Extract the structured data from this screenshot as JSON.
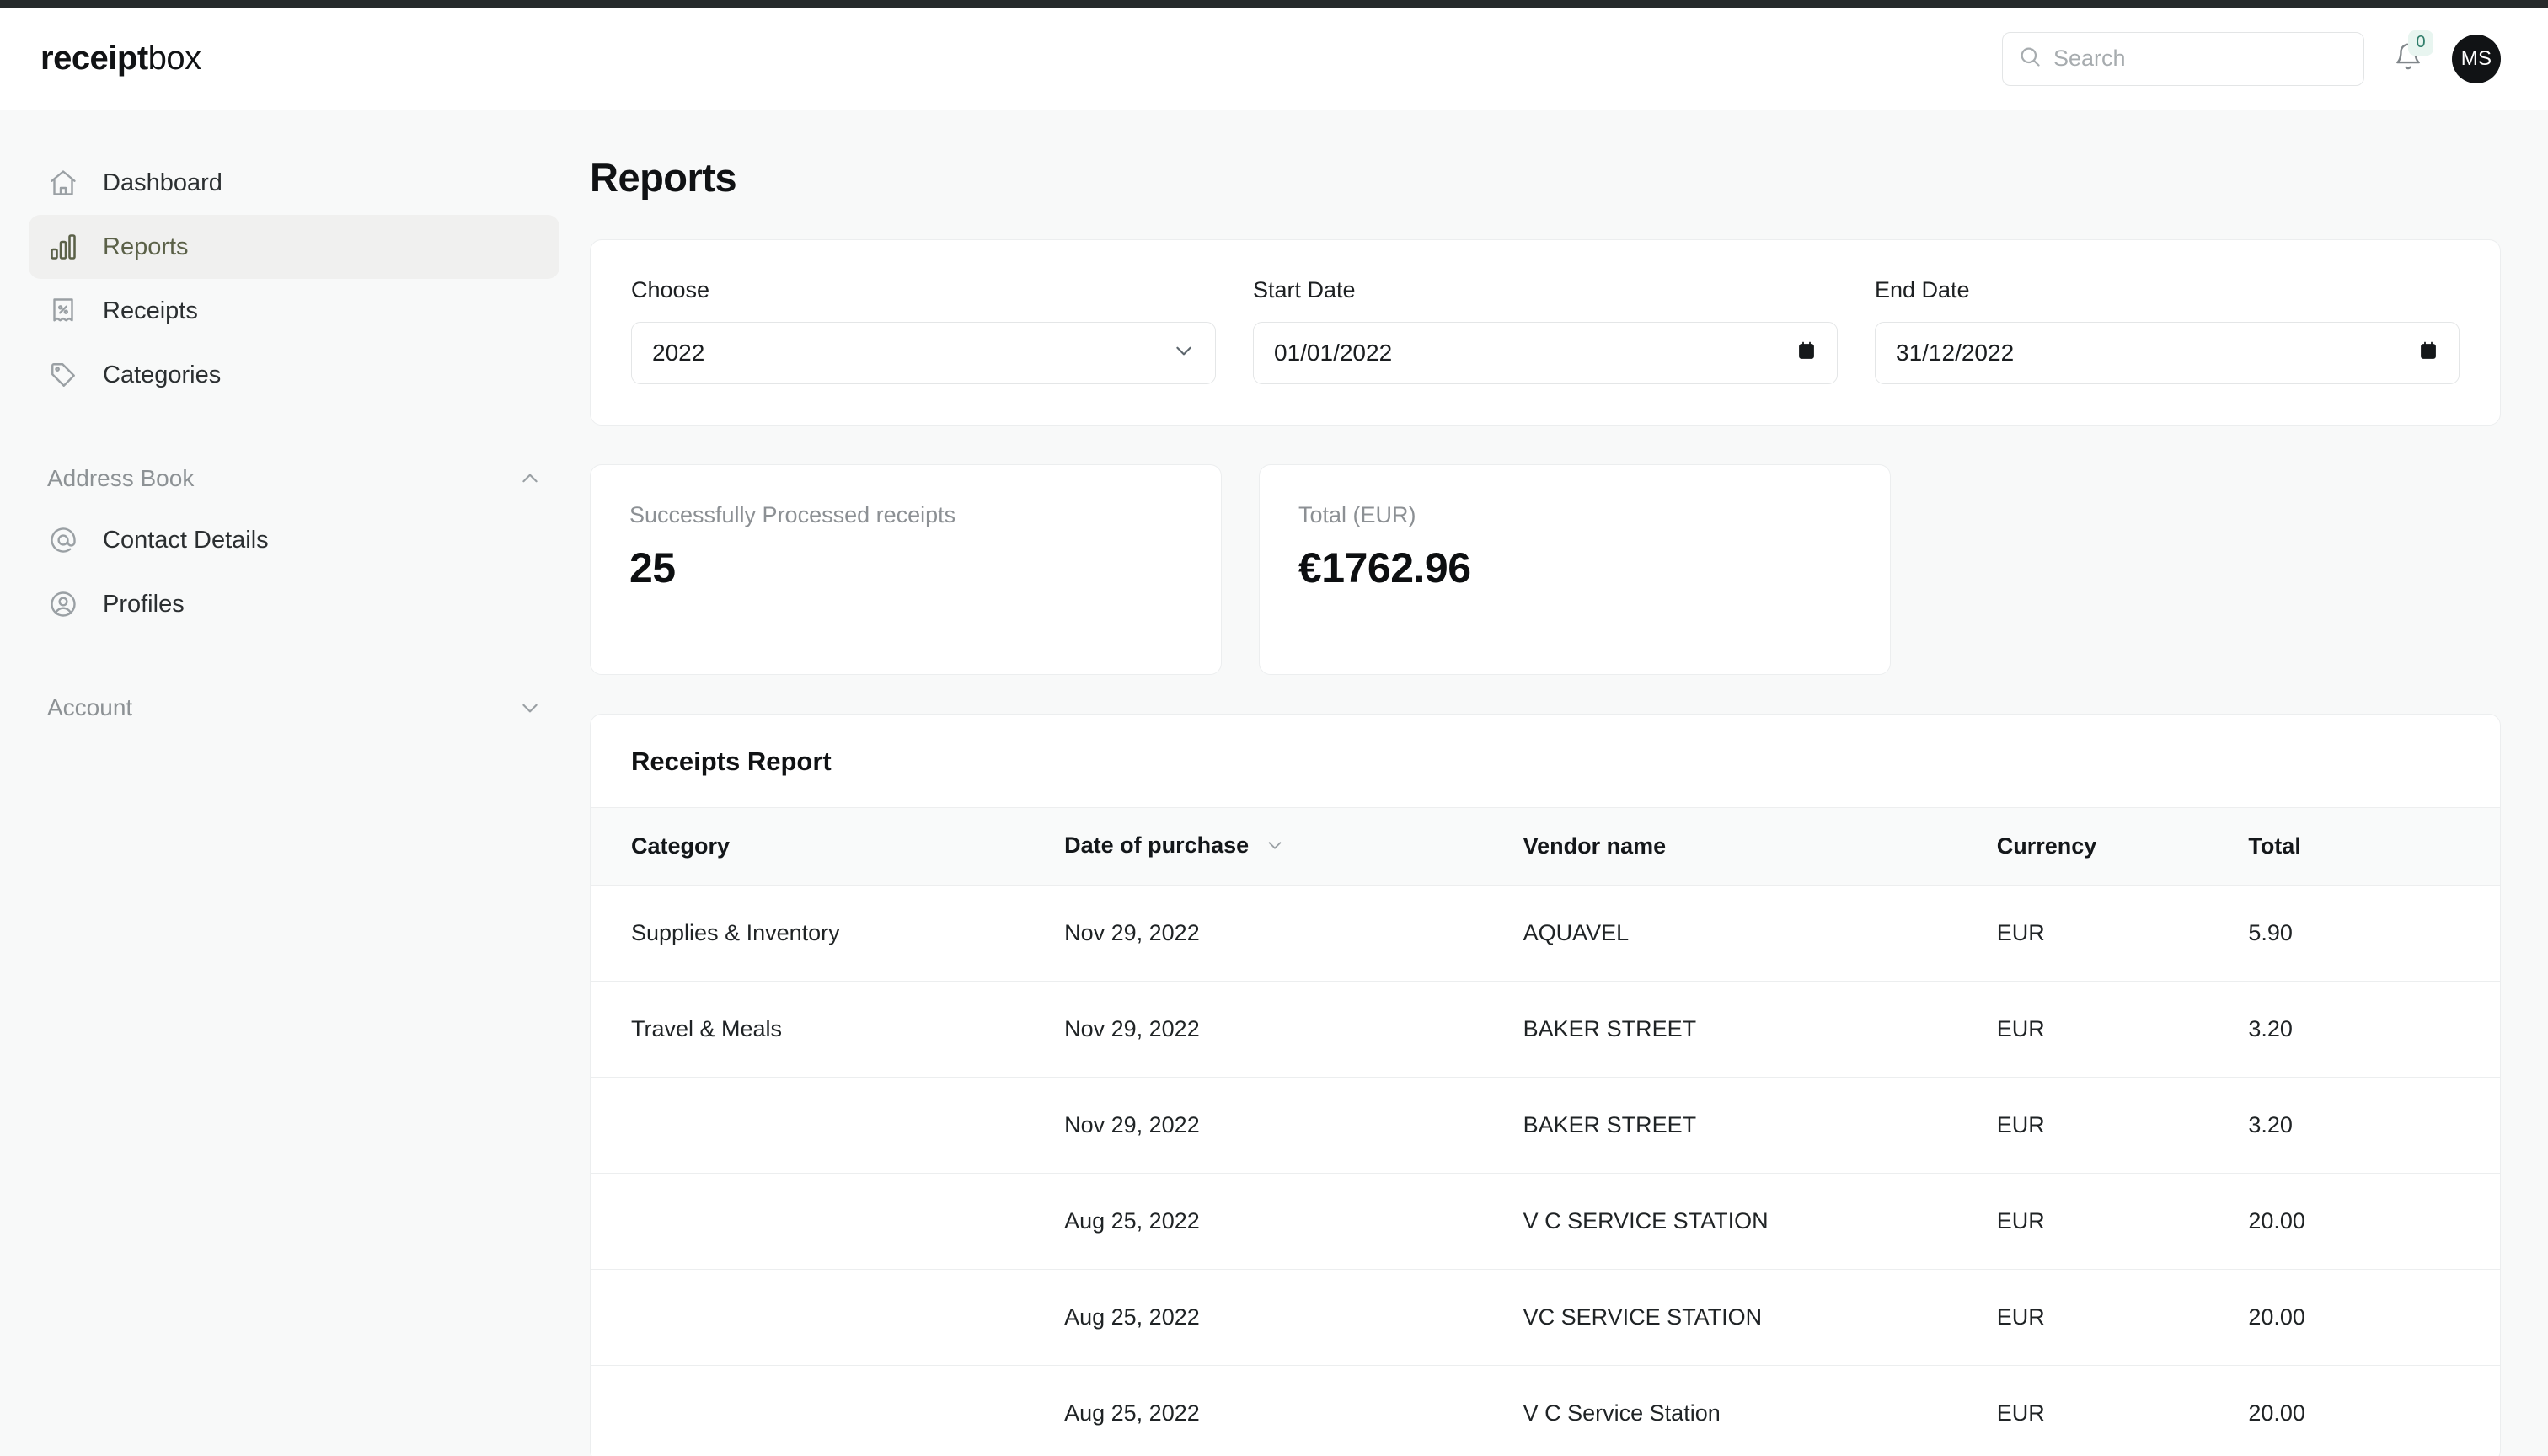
{
  "topbar": {
    "logo_bold": "receipt",
    "logo_light": "box",
    "search_placeholder": "Search",
    "search_value": "",
    "notification_count": "0",
    "avatar_initials": "MS"
  },
  "sidebar": {
    "items": [
      {
        "label": "Dashboard",
        "icon": "home-icon",
        "active": false
      },
      {
        "label": "Reports",
        "icon": "bar-chart-icon",
        "active": true
      },
      {
        "label": "Receipts",
        "icon": "receipt-icon",
        "active": false
      },
      {
        "label": "Categories",
        "icon": "tag-icon",
        "active": false
      }
    ],
    "address_book": {
      "label": "Address Book",
      "items": [
        {
          "label": "Contact Details",
          "icon": "at-sign-icon"
        },
        {
          "label": "Profiles",
          "icon": "user-circle-icon"
        }
      ]
    },
    "account": {
      "label": "Account"
    }
  },
  "main": {
    "page_title": "Reports",
    "filters": {
      "choose_label": "Choose",
      "choose_value": "2022",
      "start_label": "Start Date",
      "start_value": "01/01/2022",
      "end_label": "End Date",
      "end_value": "31/12/2022"
    },
    "stats": [
      {
        "label": "Successfully Processed receipts",
        "value": "25"
      },
      {
        "label": "Total (EUR)",
        "value": "€1762.96"
      }
    ],
    "report": {
      "title": "Receipts Report",
      "columns": [
        "Category",
        "Date of purchase",
        "Vendor name",
        "Currency",
        "Total"
      ],
      "sorted_column": "Date of purchase",
      "rows": [
        {
          "category": "Supplies & Inventory",
          "date": "Nov 29, 2022",
          "vendor": "AQUAVEL",
          "currency": "EUR",
          "total": "5.90"
        },
        {
          "category": "Travel & Meals",
          "date": "Nov 29, 2022",
          "vendor": "BAKER STREET",
          "currency": "EUR",
          "total": "3.20"
        },
        {
          "category": "",
          "date": "Nov 29, 2022",
          "vendor": "BAKER STREET",
          "currency": "EUR",
          "total": "3.20"
        },
        {
          "category": "",
          "date": "Aug 25, 2022",
          "vendor": "V C SERVICE STATION",
          "currency": "EUR",
          "total": "20.00"
        },
        {
          "category": "",
          "date": "Aug 25, 2022",
          "vendor": "VC SERVICE STATION",
          "currency": "EUR",
          "total": "20.00"
        },
        {
          "category": "",
          "date": "Aug 25, 2022",
          "vendor": "V C Service Station",
          "currency": "EUR",
          "total": "20.00"
        }
      ]
    }
  },
  "colors": {
    "accent_active": "#5b6148",
    "badge_bg": "#e8f5f0",
    "badge_text": "#2f7d6a",
    "page_bg": "#f8f9f9",
    "card_bg": "#ffffff"
  }
}
